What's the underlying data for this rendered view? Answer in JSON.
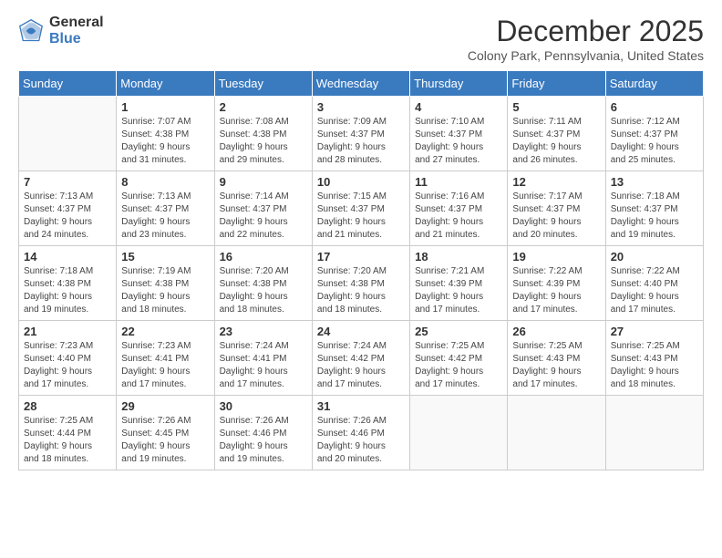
{
  "logo": {
    "general": "General",
    "blue": "Blue"
  },
  "title": "December 2025",
  "location": "Colony Park, Pennsylvania, United States",
  "days_of_week": [
    "Sunday",
    "Monday",
    "Tuesday",
    "Wednesday",
    "Thursday",
    "Friday",
    "Saturday"
  ],
  "weeks": [
    [
      {
        "day": "",
        "info": ""
      },
      {
        "day": "1",
        "info": "Sunrise: 7:07 AM\nSunset: 4:38 PM\nDaylight: 9 hours\nand 31 minutes."
      },
      {
        "day": "2",
        "info": "Sunrise: 7:08 AM\nSunset: 4:38 PM\nDaylight: 9 hours\nand 29 minutes."
      },
      {
        "day": "3",
        "info": "Sunrise: 7:09 AM\nSunset: 4:37 PM\nDaylight: 9 hours\nand 28 minutes."
      },
      {
        "day": "4",
        "info": "Sunrise: 7:10 AM\nSunset: 4:37 PM\nDaylight: 9 hours\nand 27 minutes."
      },
      {
        "day": "5",
        "info": "Sunrise: 7:11 AM\nSunset: 4:37 PM\nDaylight: 9 hours\nand 26 minutes."
      },
      {
        "day": "6",
        "info": "Sunrise: 7:12 AM\nSunset: 4:37 PM\nDaylight: 9 hours\nand 25 minutes."
      }
    ],
    [
      {
        "day": "7",
        "info": "Sunrise: 7:13 AM\nSunset: 4:37 PM\nDaylight: 9 hours\nand 24 minutes."
      },
      {
        "day": "8",
        "info": "Sunrise: 7:13 AM\nSunset: 4:37 PM\nDaylight: 9 hours\nand 23 minutes."
      },
      {
        "day": "9",
        "info": "Sunrise: 7:14 AM\nSunset: 4:37 PM\nDaylight: 9 hours\nand 22 minutes."
      },
      {
        "day": "10",
        "info": "Sunrise: 7:15 AM\nSunset: 4:37 PM\nDaylight: 9 hours\nand 21 minutes."
      },
      {
        "day": "11",
        "info": "Sunrise: 7:16 AM\nSunset: 4:37 PM\nDaylight: 9 hours\nand 21 minutes."
      },
      {
        "day": "12",
        "info": "Sunrise: 7:17 AM\nSunset: 4:37 PM\nDaylight: 9 hours\nand 20 minutes."
      },
      {
        "day": "13",
        "info": "Sunrise: 7:18 AM\nSunset: 4:37 PM\nDaylight: 9 hours\nand 19 minutes."
      }
    ],
    [
      {
        "day": "14",
        "info": "Sunrise: 7:18 AM\nSunset: 4:38 PM\nDaylight: 9 hours\nand 19 minutes."
      },
      {
        "day": "15",
        "info": "Sunrise: 7:19 AM\nSunset: 4:38 PM\nDaylight: 9 hours\nand 18 minutes."
      },
      {
        "day": "16",
        "info": "Sunrise: 7:20 AM\nSunset: 4:38 PM\nDaylight: 9 hours\nand 18 minutes."
      },
      {
        "day": "17",
        "info": "Sunrise: 7:20 AM\nSunset: 4:38 PM\nDaylight: 9 hours\nand 18 minutes."
      },
      {
        "day": "18",
        "info": "Sunrise: 7:21 AM\nSunset: 4:39 PM\nDaylight: 9 hours\nand 17 minutes."
      },
      {
        "day": "19",
        "info": "Sunrise: 7:22 AM\nSunset: 4:39 PM\nDaylight: 9 hours\nand 17 minutes."
      },
      {
        "day": "20",
        "info": "Sunrise: 7:22 AM\nSunset: 4:40 PM\nDaylight: 9 hours\nand 17 minutes."
      }
    ],
    [
      {
        "day": "21",
        "info": "Sunrise: 7:23 AM\nSunset: 4:40 PM\nDaylight: 9 hours\nand 17 minutes."
      },
      {
        "day": "22",
        "info": "Sunrise: 7:23 AM\nSunset: 4:41 PM\nDaylight: 9 hours\nand 17 minutes."
      },
      {
        "day": "23",
        "info": "Sunrise: 7:24 AM\nSunset: 4:41 PM\nDaylight: 9 hours\nand 17 minutes."
      },
      {
        "day": "24",
        "info": "Sunrise: 7:24 AM\nSunset: 4:42 PM\nDaylight: 9 hours\nand 17 minutes."
      },
      {
        "day": "25",
        "info": "Sunrise: 7:25 AM\nSunset: 4:42 PM\nDaylight: 9 hours\nand 17 minutes."
      },
      {
        "day": "26",
        "info": "Sunrise: 7:25 AM\nSunset: 4:43 PM\nDaylight: 9 hours\nand 17 minutes."
      },
      {
        "day": "27",
        "info": "Sunrise: 7:25 AM\nSunset: 4:43 PM\nDaylight: 9 hours\nand 18 minutes."
      }
    ],
    [
      {
        "day": "28",
        "info": "Sunrise: 7:25 AM\nSunset: 4:44 PM\nDaylight: 9 hours\nand 18 minutes."
      },
      {
        "day": "29",
        "info": "Sunrise: 7:26 AM\nSunset: 4:45 PM\nDaylight: 9 hours\nand 19 minutes."
      },
      {
        "day": "30",
        "info": "Sunrise: 7:26 AM\nSunset: 4:46 PM\nDaylight: 9 hours\nand 19 minutes."
      },
      {
        "day": "31",
        "info": "Sunrise: 7:26 AM\nSunset: 4:46 PM\nDaylight: 9 hours\nand 20 minutes."
      },
      {
        "day": "",
        "info": ""
      },
      {
        "day": "",
        "info": ""
      },
      {
        "day": "",
        "info": ""
      }
    ]
  ]
}
